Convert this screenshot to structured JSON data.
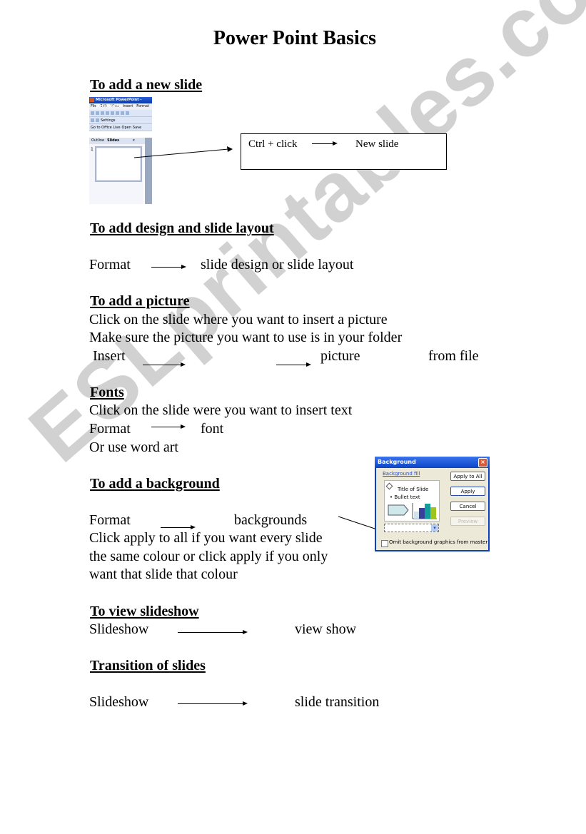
{
  "title": "Power Point Basics",
  "watermark": "ESLprintables.com",
  "colors": {
    "text": "#000000",
    "watermark": "#c9c9c9",
    "dialog_titlebar": "#0b45c8",
    "dialog_face": "#ece9d8"
  },
  "sections": {
    "new_slide": {
      "heading": "To add a new slide",
      "screenshot": {
        "window_title": "Microsoft PowerPoint - [Presentation",
        "menu": [
          "File",
          "Edit",
          "View",
          "Insert",
          "Format"
        ],
        "toolbar_settings": "Settings",
        "toolbar_office_live": "Go to Office Live",
        "toolbar_open": "Open",
        "toolbar_save": "Save",
        "tab_outline": "Outline",
        "tab_slides": "Slides",
        "close_glyph": "×",
        "slide_number": "1"
      },
      "callout": {
        "step1": "Ctrl + click",
        "step2": "New slide"
      }
    },
    "design": {
      "heading": "To add design and slide layout",
      "step1": "Format",
      "step2": "slide design or slide layout"
    },
    "picture": {
      "heading": "To add a picture",
      "line1": "Click on the slide where you want to insert a picture",
      "line2": "Make sure the picture you want to use is in your folder",
      "step1": "Insert",
      "step2": "picture",
      "step3": "from file"
    },
    "fonts": {
      "heading": "Fonts",
      "line1": "Click on the slide were you want to insert text",
      "step1": "Format",
      "step2": "font",
      "line3": "Or use word art"
    },
    "background": {
      "heading": "To add a background",
      "step1": "Format",
      "step2": "backgrounds",
      "line1": "Click apply to all if you want every slide",
      "line2": "the same colour or click apply if you only",
      "line3": "want that slide that colour",
      "dialog": {
        "title": "Background",
        "close_glyph": "×",
        "fill_label": "Background fill",
        "preview_title": "Title of Slide",
        "preview_bullet": "• Bullet text",
        "apply_all": "Apply to All",
        "apply": "Apply",
        "cancel": "Cancel",
        "preview": "Preview",
        "omit_label": "Omit background graphics from master",
        "omit_checked": false
      }
    },
    "slideshow": {
      "heading": "To view slideshow",
      "step1": "Slideshow",
      "step2": "view show"
    },
    "transition": {
      "heading": "Transition of slides",
      "step1": "Slideshow",
      "step2": "slide transition"
    }
  }
}
